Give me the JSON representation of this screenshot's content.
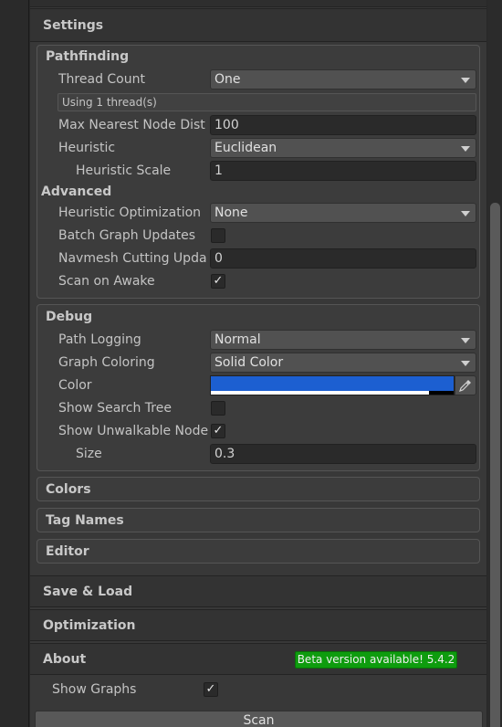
{
  "settings": {
    "title": "Settings",
    "pathfinding": {
      "title": "Pathfinding",
      "thread_count": {
        "label": "Thread Count",
        "value": "One"
      },
      "thread_info": "Using 1 thread(s)",
      "max_nearest_node_dist": {
        "label": "Max Nearest Node Dist",
        "value": "100"
      },
      "heuristic": {
        "label": "Heuristic",
        "value": "Euclidean"
      },
      "heuristic_scale": {
        "label": "Heuristic Scale",
        "value": "1"
      },
      "advanced_title": "Advanced",
      "heuristic_optimization": {
        "label": "Heuristic Optimization",
        "value": "None"
      },
      "batch_graph_updates": {
        "label": "Batch Graph Updates",
        "checked": false
      },
      "navmesh_cutting": {
        "label": "Navmesh Cutting Upda",
        "value": "0"
      },
      "scan_on_awake": {
        "label": "Scan on Awake",
        "checked": true
      }
    },
    "debug": {
      "title": "Debug",
      "path_logging": {
        "label": "Path Logging",
        "value": "Normal"
      },
      "graph_coloring": {
        "label": "Graph Coloring",
        "value": "Solid Color"
      },
      "color": {
        "label": "Color",
        "hex": "#1c5fd1"
      },
      "show_search_tree": {
        "label": "Show Search Tree",
        "checked": false
      },
      "show_unwalkable_nodes": {
        "label": "Show Unwalkable Node",
        "checked": true
      },
      "size": {
        "label": "Size",
        "value": "0.3"
      }
    },
    "collapsed_groups": [
      "Colors",
      "Tag Names",
      "Editor"
    ]
  },
  "sections": {
    "save_load": "Save & Load",
    "optimization": "Optimization",
    "about": "About"
  },
  "beta_badge": "Beta version available! 5.4.2",
  "show_graphs": {
    "label": "Show Graphs",
    "checked": true
  },
  "scan_button": "Scan",
  "check_glyph": "✓",
  "eyedropper_icon": "eyedropper-icon"
}
